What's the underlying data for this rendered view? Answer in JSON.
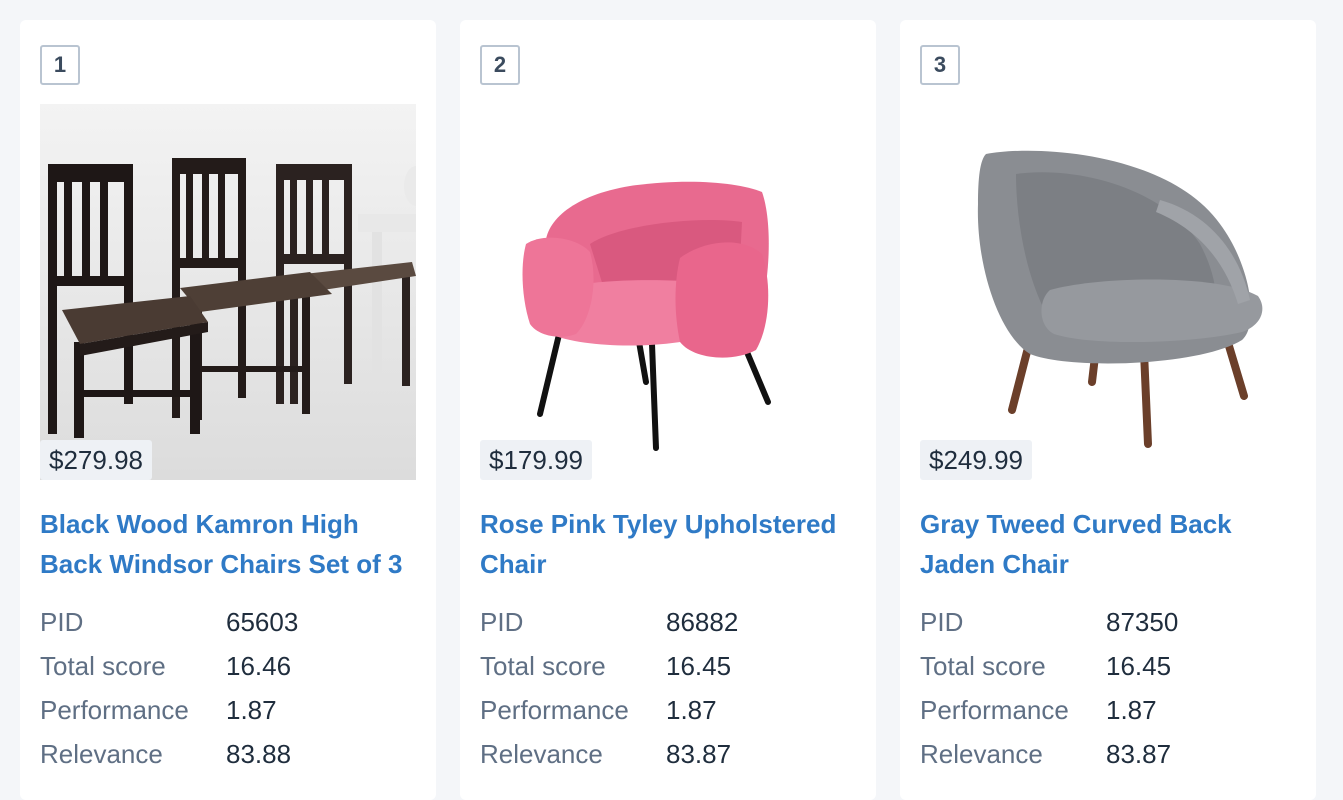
{
  "products": [
    {
      "rank": "1",
      "price": "$279.98",
      "title": "Black Wood Kamron High Back Windsor Chairs Set of 3",
      "image": "black-wood-chairs-set-image",
      "stats": [
        {
          "label": "PID",
          "value": "65603"
        },
        {
          "label": "Total score",
          "value": "16.46"
        },
        {
          "label": "Performance",
          "value": "1.87"
        },
        {
          "label": "Relevance",
          "value": "83.88"
        }
      ]
    },
    {
      "rank": "2",
      "price": "$179.99",
      "title": "Rose Pink Tyley Upholstered Chair",
      "image": "pink-upholstered-chair-image",
      "stats": [
        {
          "label": "PID",
          "value": "86882"
        },
        {
          "label": "Total score",
          "value": "16.45"
        },
        {
          "label": "Performance",
          "value": "1.87"
        },
        {
          "label": "Relevance",
          "value": "83.87"
        }
      ]
    },
    {
      "rank": "3",
      "price": "$249.99",
      "title": "Gray Tweed Curved Back Jaden Chair",
      "image": "gray-tweed-chair-image",
      "stats": [
        {
          "label": "PID",
          "value": "87350"
        },
        {
          "label": "Total score",
          "value": "16.45"
        },
        {
          "label": "Performance",
          "value": "1.87"
        },
        {
          "label": "Relevance",
          "value": "83.87"
        }
      ]
    }
  ],
  "colors": {
    "link": "#2f7ac6",
    "label": "#5f6f84",
    "value": "#1f2d3d",
    "page_bg": "#f4f6f9",
    "card_bg": "#ffffff"
  }
}
